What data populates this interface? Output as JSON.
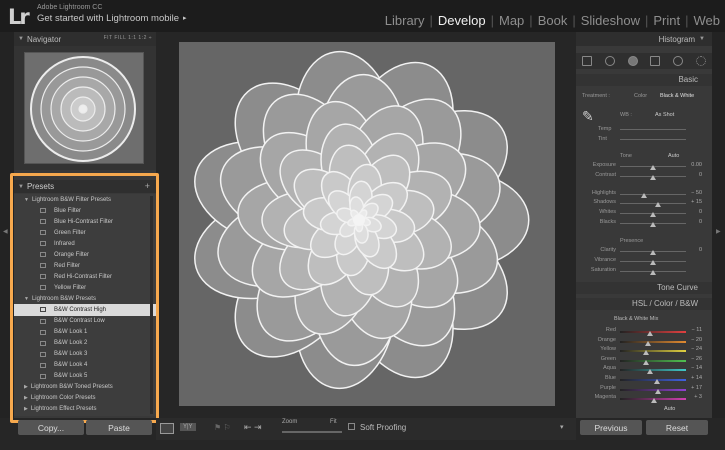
{
  "app": {
    "logo": "Lr",
    "name": "Adobe Lightroom CC",
    "mobile": "Get started with Lightroom mobile",
    "mobile_arrow": "▸"
  },
  "modules": [
    "Library",
    "Develop",
    "Map",
    "Book",
    "Slideshow",
    "Print",
    "Web"
  ],
  "active_module": "Develop",
  "navigator": {
    "title": "Navigator",
    "zoom_options": "FIT  FILL  1:1  1:2 ÷"
  },
  "presets": {
    "title": "Presets",
    "add": "+",
    "items": [
      {
        "type": "folder",
        "label": "Lightroom B&W Filter Presets",
        "open": true
      },
      {
        "type": "item",
        "label": "Blue Filter"
      },
      {
        "type": "item",
        "label": "Blue Hi-Contrast Filter"
      },
      {
        "type": "item",
        "label": "Green Filter"
      },
      {
        "type": "item",
        "label": "Infrared"
      },
      {
        "type": "item",
        "label": "Orange Filter"
      },
      {
        "type": "item",
        "label": "Red Filter"
      },
      {
        "type": "item",
        "label": "Red Hi-Contrast Filter"
      },
      {
        "type": "item",
        "label": "Yellow Filter"
      },
      {
        "type": "folder",
        "label": "Lightroom B&W Presets",
        "open": true
      },
      {
        "type": "item",
        "label": "B&W Contrast High",
        "selected": true
      },
      {
        "type": "item",
        "label": "B&W Contrast Low"
      },
      {
        "type": "item",
        "label": "B&W Look 1"
      },
      {
        "type": "item",
        "label": "B&W Look 2"
      },
      {
        "type": "item",
        "label": "B&W Look 3"
      },
      {
        "type": "item",
        "label": "B&W Look 4"
      },
      {
        "type": "item",
        "label": "B&W Look 5"
      },
      {
        "type": "folder",
        "label": "Lightroom B&W Toned Presets",
        "open": false
      },
      {
        "type": "folder",
        "label": "Lightroom Color Presets",
        "open": false
      },
      {
        "type": "folder",
        "label": "Lightroom Effect Presets",
        "open": false
      }
    ]
  },
  "left_buttons": {
    "copy": "Copy...",
    "paste": "Paste"
  },
  "toolbar": {
    "zoom_label": "Zoom",
    "zoom_fit": "Fit",
    "soft_proofing": "Soft Proofing",
    "yy": "Y|Y"
  },
  "right": {
    "histogram_title": "Histogram",
    "basic_title": "Basic",
    "treatment_label": "Treatment :",
    "treatment_color": "Color",
    "treatment_bw": "Black & White",
    "wb_label": "WB :",
    "wb_value": "As Shot",
    "temp": "Temp",
    "tint": "Tint",
    "tone_label": "Tone",
    "tone_auto": "Auto",
    "exposure": "Exposure",
    "exposure_val": "0.00",
    "contrast": "Contrast",
    "contrast_val": "0",
    "highlights": "Highlights",
    "highlights_val": "− 50",
    "shadows": "Shadows",
    "shadows_val": "+ 15",
    "whites": "Whites",
    "whites_val": "0",
    "blacks": "Blacks",
    "blacks_val": "0",
    "presence_label": "Presence",
    "clarity": "Clarity",
    "clarity_val": "0",
    "vibrance": "Vibrance",
    "saturation": "Saturation",
    "tone_curve_title": "Tone Curve",
    "hsl_title": "HSL  /  Color  /  B&W",
    "bw_mix_title": "Black & White Mix",
    "bw_mix": [
      {
        "name": "Red",
        "value": "− 11",
        "level": 0.46,
        "color": "#e04040"
      },
      {
        "name": "Orange",
        "value": "− 20",
        "level": 0.42,
        "color": "#e08a30"
      },
      {
        "name": "Yellow",
        "value": "− 24",
        "level": 0.4,
        "color": "#e0d040"
      },
      {
        "name": "Green",
        "value": "− 26",
        "level": 0.39,
        "color": "#50c050"
      },
      {
        "name": "Aqua",
        "value": "− 14",
        "level": 0.45,
        "color": "#40c8c8"
      },
      {
        "name": "Blue",
        "value": "+ 14",
        "level": 0.56,
        "color": "#4060e0"
      },
      {
        "name": "Purple",
        "value": "+ 17",
        "level": 0.58,
        "color": "#9040d0"
      },
      {
        "name": "Magenta",
        "value": "+ 3",
        "level": 0.51,
        "color": "#d040b0"
      }
    ],
    "bw_auto": "Auto",
    "previous": "Previous",
    "reset": "Reset"
  },
  "colors": {
    "highlight": "#f7a94e",
    "bg": "#262626",
    "panel": "#393939"
  }
}
